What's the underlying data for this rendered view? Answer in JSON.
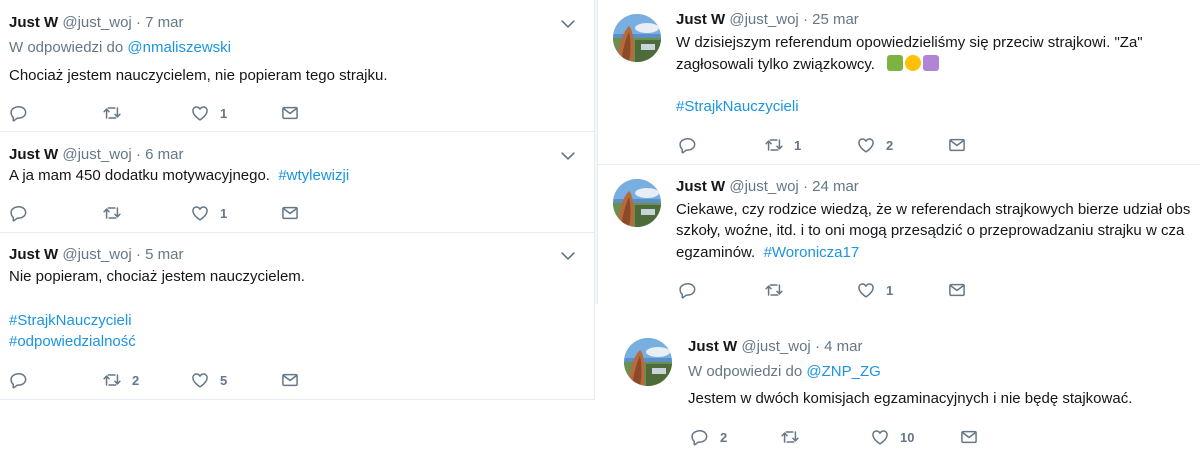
{
  "author": {
    "name": "Just W",
    "handle": "@just_woj"
  },
  "colors": {
    "link": "#1b95e0",
    "muted": "#657786",
    "text": "#14171a",
    "border": "#e6ecf0"
  },
  "left_tweets": [
    {
      "date": "7 mar",
      "reply_prefix": "W odpowiedzi do",
      "reply_to": "@nmaliszewski",
      "line1": "Chociaż jestem nauczycielem, nie popieram tego strajku.",
      "reply_count": "",
      "retweet_count": "",
      "like_count": "1"
    },
    {
      "date": "6 mar",
      "line1": "A ja mam 450 dodatku motywacyjnego.",
      "hashtag": "#wtylewizji",
      "reply_count": "",
      "retweet_count": "",
      "like_count": "1"
    },
    {
      "date": "5 mar",
      "line1": "Nie popieram, chociaż jestem nauczycielem.",
      "hashtag1": "#StrajkNauczycieli",
      "hashtag2": "#odpowiedzialność",
      "reply_count": "",
      "retweet_count": "2",
      "like_count": "5"
    }
  ],
  "right_tweets": [
    {
      "date": "25 mar",
      "line1": "W dzisiejszym referendum opowiedzieliśmy się przeciw  strajkowi. \"Za\"",
      "line2": "zagłosowali tylko związkowcy.",
      "emojis": [
        "teacher-emoji",
        "smile-emoji",
        "woman-facepalm-emoji"
      ],
      "hashtag": "#StrajkNauczycieli",
      "reply_count": "",
      "retweet_count": "1",
      "like_count": "2"
    },
    {
      "date": "24 mar",
      "line1": "Ciekawe, czy rodzice wiedzą, że w referendach strajkowych bierze udział obs",
      "line2": "szkoły, woźne, itd. i to oni mogą przesądzić o przeprowadzaniu strajku w cza",
      "line3": "egzaminów.",
      "hashtag": "#Woronicza17",
      "reply_count": "",
      "retweet_count": "",
      "like_count": "1"
    },
    {
      "date": "4 mar",
      "reply_prefix": "W odpowiedzi do",
      "reply_to": "@ZNP_ZG",
      "line1": "Jestem w dwóch komisjach egzaminacyjnych i nie będę stajkować.",
      "reply_count": "2",
      "retweet_count": "",
      "like_count": "10"
    }
  ]
}
